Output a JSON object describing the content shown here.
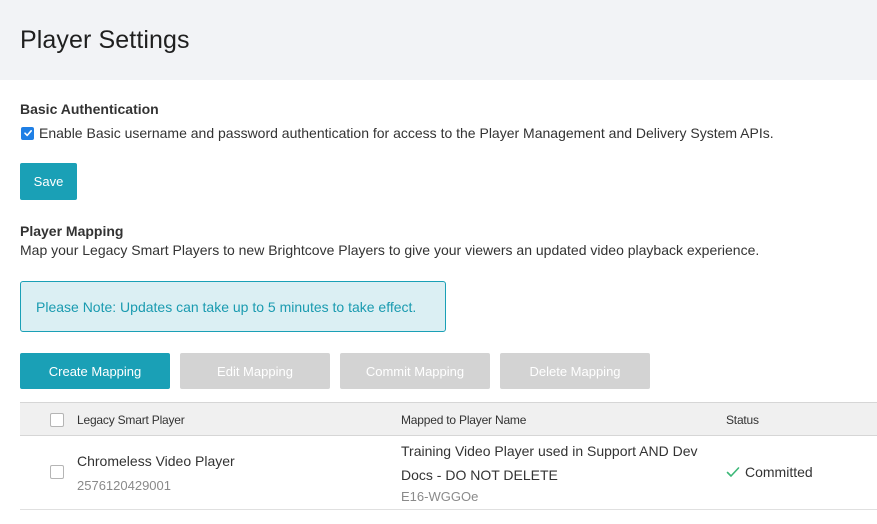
{
  "header": {
    "title": "Player Settings"
  },
  "basic_auth": {
    "title": "Basic Authentication",
    "checkbox_checked": true,
    "checkbox_label": "Enable Basic username and password authentication for access to the Player Management and Delivery System APIs.",
    "save_label": "Save"
  },
  "player_mapping": {
    "title": "Player Mapping",
    "description": "Map your Legacy Smart Players to new Brightcove Players to give your viewers an updated video playback experience.",
    "note": "Please Note: Updates can take up to 5 minutes to take effect."
  },
  "actions": {
    "create": "Create Mapping",
    "edit": "Edit Mapping",
    "commit": "Commit Mapping",
    "delete": "Delete Mapping"
  },
  "table": {
    "columns": [
      "Legacy Smart Player",
      "Mapped to Player Name",
      "Status"
    ],
    "rows": [
      {
        "legacy_name": "Chromeless Video Player",
        "legacy_id": "2576120429001",
        "mapped_name": "Training Video Player used in Support AND Dev Docs - DO NOT DELETE",
        "mapped_id": "E16-WGGOe",
        "status": "Committed"
      }
    ]
  },
  "colors": {
    "accent": "#1aa0b6",
    "checkbox": "#1f7fe5",
    "status_check": "#3cb878",
    "disabled": "#d3d3d3"
  },
  "icons": {
    "checkbox": "checkmark-icon",
    "status": "check-icon"
  }
}
